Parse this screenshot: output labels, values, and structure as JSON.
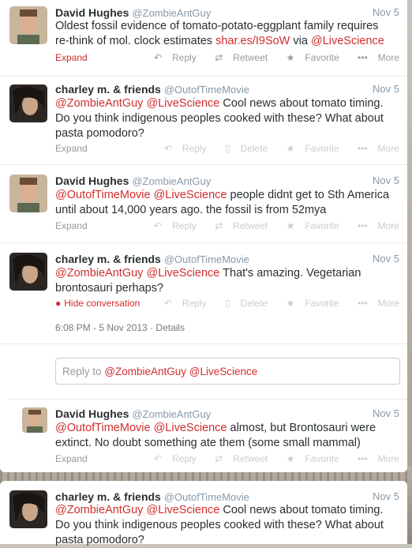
{
  "tweets": [
    {
      "name": "David Hughes",
      "handle": "@ZombieAntGuy",
      "time": "Nov 5",
      "text_pre": "Oldest fossil evidence of tomato-potato-eggplant family requires re-think of mol.  clock estimates ",
      "link1": "shar.es/I9SoW",
      "text_mid": " via ",
      "link2": "@LiveScience",
      "expand": "Expand",
      "actions": [
        "Reply",
        "Retweet",
        "Favorite",
        "More"
      ]
    },
    {
      "name": "charley m. & friends",
      "handle": "@OutofTimeMovie",
      "time": "Nov 5",
      "link1": "@ZombieAntGuy",
      "link2": "@LiveScience",
      "text": " Cool news about tomato timing. Do you think indigenous peoples cooked with these? What about pasta pomodoro?",
      "expand": "Expand",
      "actions": [
        "Reply",
        "Delete",
        "Favorite",
        "More"
      ]
    },
    {
      "name": "David Hughes",
      "handle": "@ZombieAntGuy",
      "time": "Nov 5",
      "link1": "@OutofTimeMovie",
      "link2": "@LiveScience",
      "text": " people didnt get to Sth America until about 14,000 years ago. the fossil is from 52mya",
      "expand": "Expand",
      "actions": [
        "Reply",
        "Retweet",
        "Favorite",
        "More"
      ]
    },
    {
      "name": "charley m. & friends",
      "handle": "@OutofTimeMovie",
      "time": "Nov 5",
      "link1": "@ZombieAntGuy",
      "link2": "@LiveScience",
      "text": " That's amazing. Vegetarian brontosauri perhaps?",
      "expand": "Hide conversation",
      "actions": [
        "Reply",
        "Delete",
        "Favorite",
        "More"
      ],
      "details_time": "6:08 PM - 5 Nov 2013",
      "details_sep": " · ",
      "details_link": "Details"
    }
  ],
  "reply_box": {
    "prefix": "Reply to ",
    "mention1": "@ZombieAntGuy",
    "mention2": "@LiveScience"
  },
  "reply_tweet": {
    "name": "David Hughes",
    "handle": "@ZombieAntGuy",
    "time": "Nov 5",
    "link1": "@OutofTimeMovie",
    "link2": "@LiveScience",
    "text": " almost, but Brontosauri were extinct. No doubt something ate them (some small mammal)",
    "expand": "Expand",
    "actions": [
      "Reply",
      "Retweet",
      "Favorite",
      "More"
    ]
  },
  "bottom_tweet": {
    "name": "charley m. & friends",
    "handle": "@OutofTimeMovie",
    "time": "Nov 5",
    "link1": "@ZombieAntGuy",
    "link2": "@LiveScience",
    "text": " Cool news about tomato timing. Do you think indigenous peoples cooked with these? What about pasta pomodoro?"
  },
  "colors": {
    "link": "#d22d2d",
    "muted": "#8899a6",
    "text": "#292f33"
  },
  "icons": [
    "reply-icon",
    "retweet-icon",
    "delete-icon",
    "favorite-icon",
    "more-icon",
    "conversation-icon"
  ]
}
